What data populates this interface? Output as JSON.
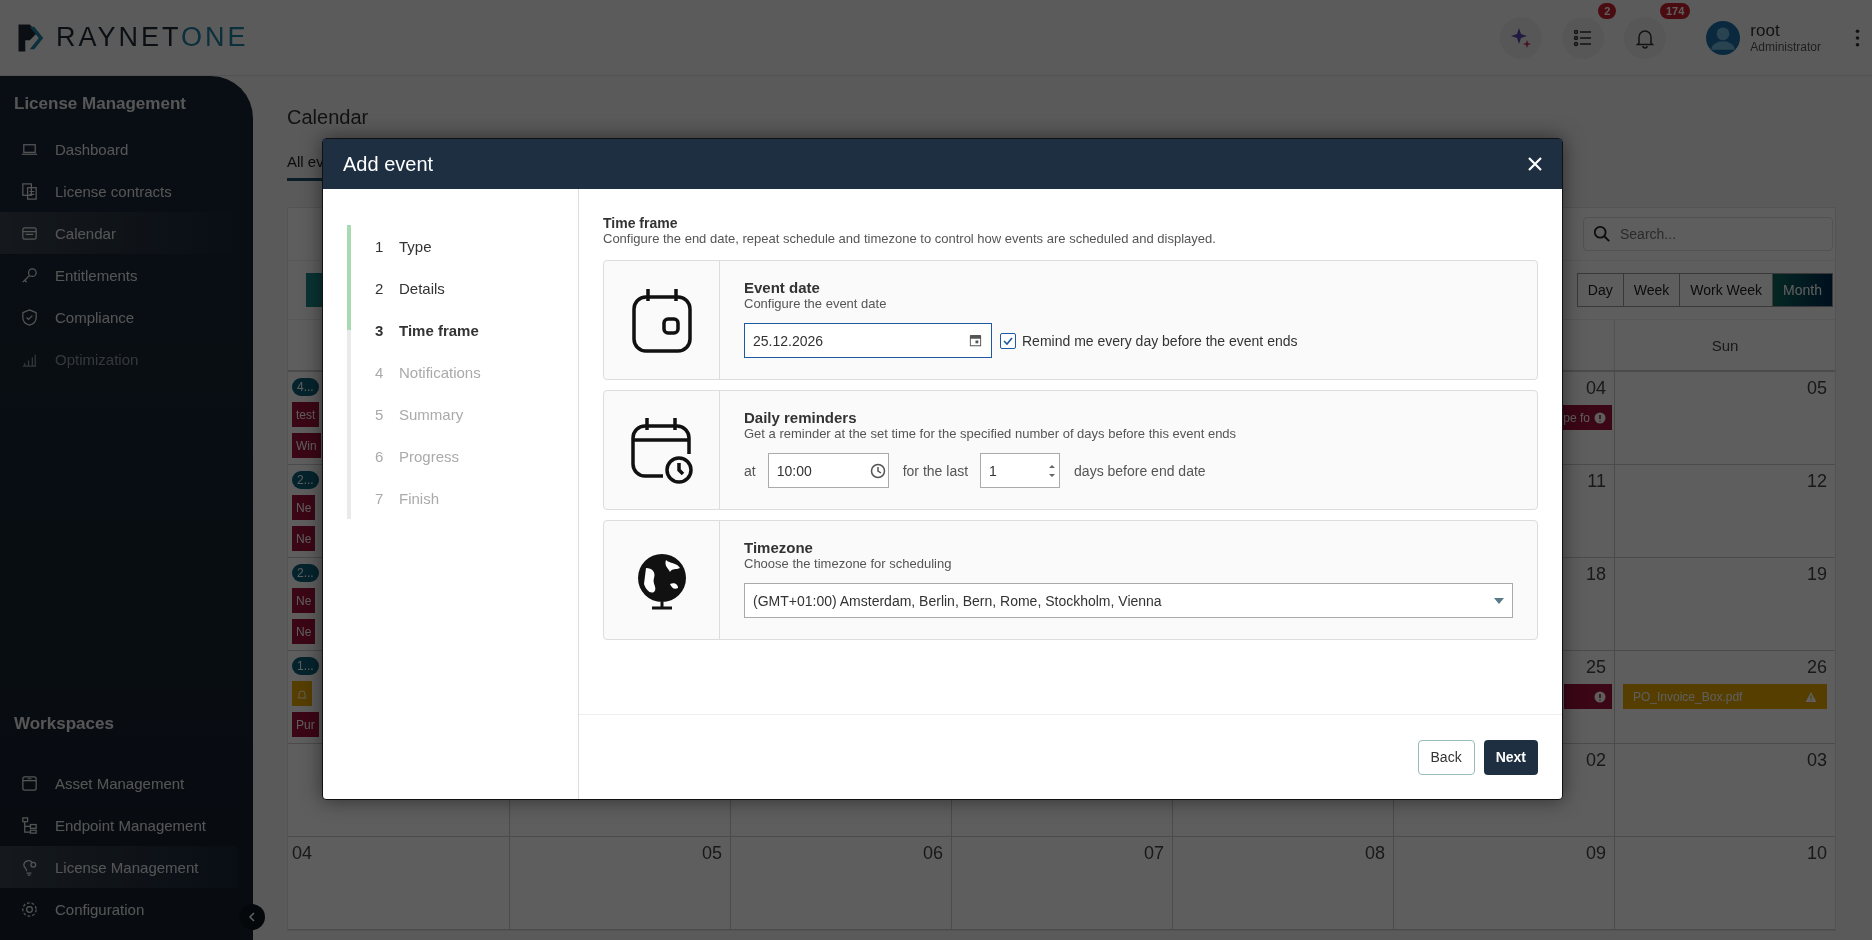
{
  "top_bar": {
    "logo": {
      "word": "RAYNET",
      "accent": "ONE"
    },
    "tasks_badge": "2",
    "notifications_badge": "174",
    "user": {
      "name": "root",
      "role": "Administrator"
    }
  },
  "sidebar": {
    "sections": [
      {
        "title": "License Management",
        "items": [
          {
            "label": "Dashboard",
            "selected": false,
            "disabled": false
          },
          {
            "label": "License contracts",
            "selected": false,
            "disabled": false
          },
          {
            "label": "Calendar",
            "selected": true,
            "disabled": false
          },
          {
            "label": "Entitlements",
            "selected": false,
            "disabled": false
          },
          {
            "label": "Compliance",
            "selected": false,
            "disabled": false
          },
          {
            "label": "Optimization",
            "selected": false,
            "disabled": true
          }
        ]
      },
      {
        "title": "Workspaces",
        "items": [
          {
            "label": "Asset Management",
            "selected": false,
            "disabled": false
          },
          {
            "label": "Endpoint Management",
            "selected": false,
            "disabled": false
          },
          {
            "label": "License Management",
            "selected": true,
            "disabled": false
          },
          {
            "label": "Configuration",
            "selected": false,
            "disabled": false
          }
        ]
      }
    ]
  },
  "page": {
    "title": "Calendar",
    "tabs": [
      {
        "label": "All ev",
        "selected": true
      }
    ],
    "calendar": {
      "search": {
        "placeholder": "Search..."
      },
      "views": [
        {
          "label": "Day",
          "selected": false
        },
        {
          "label": "Week",
          "selected": false
        },
        {
          "label": "Work Week",
          "selected": false
        },
        {
          "label": "Month",
          "selected": true
        }
      ],
      "weekday_headers": [
        "Sun"
      ],
      "weeks": [
        {
          "cells": [
            {
              "badge": "4...",
              "events": [
                {
                  "kind": "alert",
                  "text": "test"
                },
                {
                  "kind": "alert",
                  "text": "Win"
                }
              ]
            },
            {},
            {},
            {},
            {},
            {
              "number": "04",
              "events": [
                {
                  "kind": "alert",
                  "text": "pe fo"
                }
              ]
            },
            {
              "number": "05"
            }
          ]
        },
        {
          "cells": [
            {
              "badge": "2...",
              "events": [
                {
                  "kind": "alert",
                  "text": "Ne"
                },
                {
                  "kind": "alert",
                  "text": "Ne"
                }
              ]
            },
            {},
            {},
            {},
            {},
            {
              "number": "11"
            },
            {
              "number": "12"
            }
          ]
        },
        {
          "cells": [
            {
              "badge": "2...",
              "events": [
                {
                  "kind": "alert",
                  "text": "Ne"
                },
                {
                  "kind": "alert",
                  "text": "Ne"
                }
              ]
            },
            {},
            {},
            {},
            {},
            {
              "number": "18"
            },
            {
              "number": "19"
            }
          ]
        },
        {
          "cells": [
            {
              "badge": "1...",
              "events": [
                {
                  "kind": "reminder"
                },
                {
                  "kind": "alert",
                  "text": "Pur"
                }
              ]
            },
            {},
            {},
            {},
            {},
            {
              "number": "25",
              "events": [
                {
                  "kind": "alert"
                }
              ]
            },
            {
              "number": "26",
              "events": [
                {
                  "kind": "warning",
                  "text": "PO_Invoice_Box.pdf"
                }
              ]
            }
          ]
        },
        {
          "cells": [
            {},
            {},
            {},
            {},
            {},
            {
              "number": "02"
            },
            {
              "number": "03"
            }
          ]
        },
        {
          "cells": [
            {
              "number": "04"
            },
            {
              "number": "05"
            },
            {
              "number": "06"
            },
            {
              "number": "07"
            },
            {
              "number": "08"
            },
            {
              "number": "09"
            },
            {
              "number": "10"
            }
          ]
        }
      ]
    }
  },
  "dialog": {
    "title": "Add event",
    "steps": [
      {
        "number": "1",
        "label": "Type",
        "completed": true,
        "selected": false
      },
      {
        "number": "2",
        "label": "Details",
        "completed": true,
        "selected": false
      },
      {
        "number": "3",
        "label": "Time frame",
        "completed": false,
        "selected": true
      },
      {
        "number": "4",
        "label": "Notifications",
        "completed": false,
        "selected": false
      },
      {
        "number": "5",
        "label": "Summary",
        "completed": false,
        "selected": false
      },
      {
        "number": "6",
        "label": "Progress",
        "completed": false,
        "selected": false
      },
      {
        "number": "7",
        "label": "Finish",
        "completed": false,
        "selected": false
      }
    ],
    "section": {
      "title": "Time frame",
      "description": "Configure the end date, repeat schedule and timezone to control how events are scheduled and displayed."
    },
    "cards": [
      {
        "kind": "event_date",
        "title": "Event date",
        "description": "Configure the event date",
        "date": "25.12.2026",
        "reminder": {
          "label": "Remind me every day before the event ends",
          "checked": true
        }
      },
      {
        "kind": "daily_reminders",
        "title": "Daily reminders",
        "description": "Get a reminder at the set time for the specified number of days before this event ends",
        "at_label": "at",
        "time": "10:00",
        "for_label": "for the last",
        "days": "1",
        "suffix": "days before end date"
      },
      {
        "kind": "timezone",
        "title": "Timezone",
        "description": "Choose the timezone for scheduling",
        "value": "(GMT+01:00) Amsterdam, Berlin, Bern, Rome, Stockholm, Vienna"
      }
    ],
    "buttons": {
      "back": "Back",
      "next": "Next"
    }
  }
}
